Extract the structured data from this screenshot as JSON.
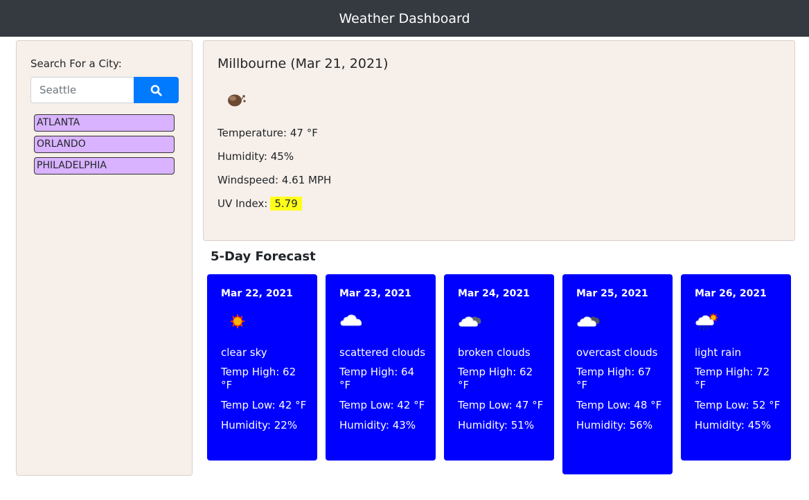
{
  "header": {
    "title": "Weather Dashboard"
  },
  "sidebar": {
    "search_label": "Search For a City:",
    "search_placeholder": "Seattle",
    "history": [
      "ATLANTA",
      "ORLANDO",
      "PHILADELPHIA"
    ]
  },
  "current": {
    "title": "Millbourne (Mar 21, 2021)",
    "icon": "smoke-icon",
    "temperature": "Temperature: 47 °F",
    "humidity": "Humidity: 45%",
    "windspeed": "Windspeed: 4.61 MPH",
    "uv_label": "UV Index:",
    "uv_value": "5.79",
    "uv_color": "#ffff1a"
  },
  "forecast": {
    "title": "5-Day Forecast",
    "card_color": "#0000ff",
    "days": [
      {
        "date": "Mar 22, 2021",
        "icon": "sun-icon",
        "description": "clear sky",
        "high": "Temp High: 62 °F",
        "low": "Temp Low: 42 °F",
        "humidity": "Humidity: 22%"
      },
      {
        "date": "Mar 23, 2021",
        "icon": "cloud-icon",
        "description": "scattered clouds",
        "high": "Temp High: 64 °F",
        "low": "Temp Low: 42 °F",
        "humidity": "Humidity: 43%"
      },
      {
        "date": "Mar 24, 2021",
        "icon": "broken-clouds-icon",
        "description": "broken clouds",
        "high": "Temp High: 62 °F",
        "low": "Temp Low: 47 °F",
        "humidity": "Humidity: 51%"
      },
      {
        "date": "Mar 25, 2021",
        "icon": "overcast-clouds-icon",
        "description": "overcast clouds",
        "high": "Temp High: 67 °F",
        "low": "Temp Low: 48 °F",
        "humidity": "Humidity: 56%"
      },
      {
        "date": "Mar 26, 2021",
        "icon": "light-rain-icon",
        "description": "light rain",
        "high": "Temp High: 72 °F",
        "low": "Temp Low: 52 °F",
        "humidity": "Humidity: 45%"
      }
    ]
  }
}
